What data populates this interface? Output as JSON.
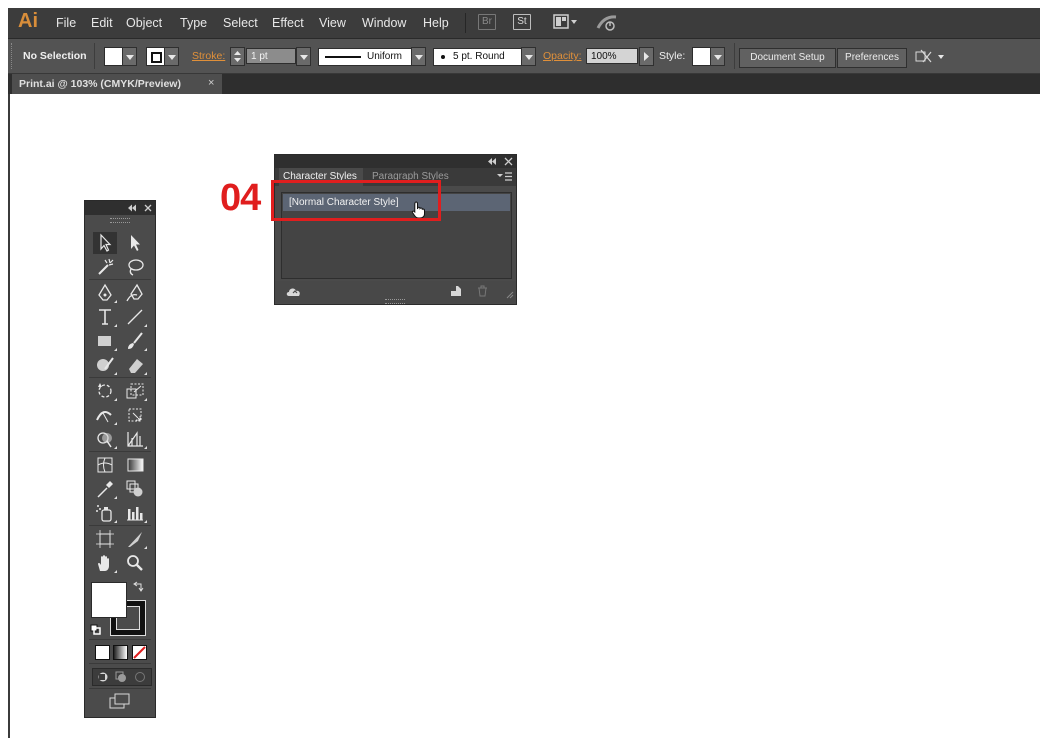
{
  "app": {
    "logo": "Ai"
  },
  "menu": [
    "File",
    "Edit",
    "Object",
    "Type",
    "Select",
    "Effect",
    "View",
    "Window",
    "Help"
  ],
  "menu_icons": {
    "bridge": "Br",
    "stock": "St",
    "arrange": "arrange-documents-icon",
    "sync": "sync-settings-icon"
  },
  "control_bar": {
    "selection": "No Selection",
    "stroke_label": "Stroke:",
    "stroke_weight": "1 pt",
    "profile": "Uniform",
    "brush": "5 pt. Round",
    "opacity_label": "Opacity:",
    "opacity_value": "100%",
    "style_label": "Style:",
    "document_setup": "Document Setup",
    "preferences": "Preferences"
  },
  "document": {
    "tab_title": "Print.ai @ 103% (CMYK/Preview)",
    "close": "×"
  },
  "character_styles_panel": {
    "tab_active": "Character Styles",
    "tab_inactive": "Paragraph Styles",
    "items": [
      "[Normal Character Style]"
    ]
  },
  "annotation": {
    "step": "04",
    "color": "#e01e1e"
  },
  "colors": {
    "menubar": "#3c3c3c",
    "controlbar": "#535353",
    "panel": "#4a4a4a",
    "accent": "#e0903a"
  }
}
